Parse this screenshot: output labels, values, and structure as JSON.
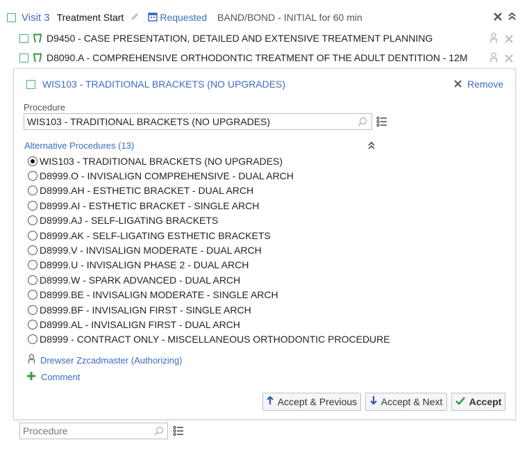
{
  "visit": {
    "title": "Visit 3",
    "step": "Treatment Start",
    "status": "Requested",
    "appointment": "BAND/BOND - INITIAL for 60 min"
  },
  "procedures": [
    {
      "code": "D9450 - CASE PRESENTATION, DETAILED AND EXTENSIVE TREATMENT PLANNING"
    },
    {
      "code": "D8090.A - COMPREHENSIVE ORTHODONTIC TREATMENT OF THE ADULT DENTITION - 12M"
    }
  ],
  "panel": {
    "title": "WIS103 - TRADITIONAL BRACKETS (NO UPGRADES)",
    "remove_label": "Remove",
    "procedure_label": "Procedure",
    "procedure_value": "WIS103 - TRADITIONAL BRACKETS (NO UPGRADES)",
    "alternatives_header": "Alternative Procedures (13)",
    "alternatives": [
      "WIS103 - TRADITIONAL BRACKETS (NO UPGRADES)",
      "D8999.O - INVISALIGN COMPREHENSIVE - DUAL ARCH",
      "D8999.AH - ESTHETIC BRACKET - DUAL ARCH",
      "D8999.AI - ESTHETIC BRACKET - SINGLE ARCH",
      "D8999.AJ - SELF-LIGATING BRACKETS",
      "D8999.AK - SELF-LIGATING ESTHETIC BRACKETS",
      "D8999.V - INVISALIGN MODERATE - DUAL ARCH",
      "D8999.U - INVISALIGN PHASE 2 - DUAL ARCH",
      "D8999.W - SPARK ADVANCED - DUAL ARCH",
      "D8999.BE - INVISALIGN MODERATE - SINGLE ARCH",
      "D8999.BF - INVISALIGN FIRST - SINGLE ARCH",
      "D8999.AL - INVISALIGN FIRST - DUAL ARCH",
      "D8999 - CONTRACT ONLY - MISCELLANEOUS ORTHODONTIC PROCEDURE"
    ],
    "selected_index": 0,
    "provider": "Drewser Zzcadmaster (Authorizing)",
    "comment_label": "Comment",
    "buttons": {
      "accept_previous": "Accept & Previous",
      "accept_next": "Accept & Next",
      "accept": "Accept"
    }
  },
  "bottom_search": {
    "placeholder": "Procedure"
  },
  "colors": {
    "link": "#3a6bc4",
    "green": "#3a9a4a",
    "checkbox": "#4aa79e"
  }
}
